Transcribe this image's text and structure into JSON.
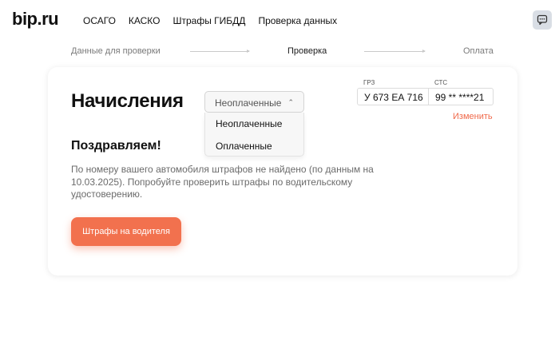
{
  "header": {
    "logo": "bip.ru",
    "nav": [
      "ОСАГО",
      "КАСКО",
      "Штрафы ГИБДД",
      "Проверка данных"
    ],
    "chat_icon": "chat-bubble-icon"
  },
  "steps": {
    "step1": "Данные для проверки",
    "step2": "Проверка",
    "step3": "Оплата",
    "active": 2
  },
  "main": {
    "title": "Начисления",
    "filter": {
      "selected": "Неоплаченные",
      "options": [
        "Неоплаченные",
        "Оплаченные"
      ]
    },
    "vehicle": {
      "grz_label": "ГРЗ",
      "grz_value": "У 673 ЕА 716",
      "sts_label": "СТС",
      "sts_value": "99 ** ****21",
      "change_label": "Изменить"
    },
    "congrats": "Поздравляем!",
    "message": "По номеру вашего автомобиля штрафов не найдено (по данным на 10.03.2025). Попробуйте проверить штрафы по водительскому удостоверению.",
    "driver_button": "Штрафы на водителя"
  },
  "colors": {
    "accent": "#f2714e",
    "link": "#f0694a"
  }
}
